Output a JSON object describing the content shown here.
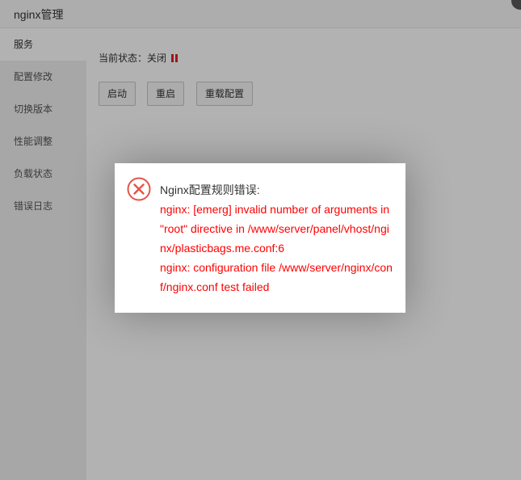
{
  "window": {
    "title": "nginx管理"
  },
  "sidebar": {
    "items": [
      {
        "label": "服务",
        "active": true
      },
      {
        "label": "配置修改"
      },
      {
        "label": "切换版本"
      },
      {
        "label": "性能调整"
      },
      {
        "label": "负载状态"
      },
      {
        "label": "错误日志"
      }
    ]
  },
  "main": {
    "status_label": "当前状态：关闭",
    "status_icon": "pause-icon",
    "status_color": "#e62020",
    "buttons": {
      "start": "启动",
      "restart": "重启",
      "reload": "重载配置"
    }
  },
  "dialog": {
    "icon": "error-circle-x-icon",
    "icon_color": "#e4544a",
    "heading": "Nginx配置规则错误:",
    "lines": [
      "nginx: [emerg] invalid number of arguments in \"root\" directive in /www/server/panel/vhost/nginx/plasticbags.me.conf:6",
      "nginx: configuration file /www/server/nginx/conf/nginx.conf test failed"
    ],
    "error_color": "#ff0000"
  }
}
